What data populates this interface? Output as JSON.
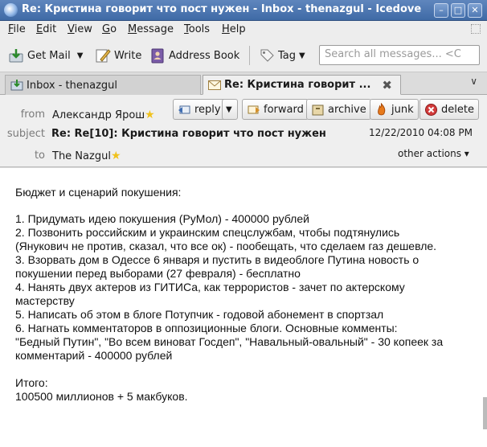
{
  "window": {
    "title": "Re: Кристина говорит что пост нужен - Inbox - thenazgul - Icedove"
  },
  "menu": [
    {
      "u": "F",
      "rest": "ile"
    },
    {
      "u": "E",
      "rest": "dit"
    },
    {
      "u": "V",
      "rest": "iew"
    },
    {
      "u": "G",
      "rest": "o"
    },
    {
      "u": "M",
      "rest": "essage"
    },
    {
      "u": "T",
      "rest": "ools"
    },
    {
      "u": "H",
      "rest": "elp"
    }
  ],
  "toolbar": {
    "get_mail": "Get Mail",
    "write": "Write",
    "address_book": "Address Book",
    "tag": "Tag",
    "search_placeholder": "Search all messages... <C"
  },
  "tabs": {
    "inbox_label": "Inbox - thenazgul",
    "message_label": "Re: Кристина говорит ..."
  },
  "header": {
    "from_label": "from",
    "from_value": "Александр Ярош",
    "subject_label": "subject",
    "subject_value": "Re: Re[10]: Кристина говорит что пост нужен",
    "to_label": "to",
    "to_value": "The Nazgul",
    "date": "12/22/2010 04:08 PM",
    "other_actions": "other actions",
    "buttons": {
      "reply": "reply",
      "forward": "forward",
      "archive": "archive",
      "junk": "junk",
      "delete": "delete"
    }
  },
  "body_lines": [
    "Бюджет и сценарий покушения:",
    "",
    "1. Придумать идею покушения (РуМол) - 400000 рублей",
    "2. Позвонить российским и украинским спецслужбам, чтобы подтянулись",
    "(Янукович не против, сказал, что все ок)  - пообещать, что сделаем газ дешевле.",
    "3. Взорвать дом в Одессе 6 января и пустить в видеоблоге Путина новость о",
    "покушении перед выборами (27 февраля) - бесплатно",
    "4. Нанять двух актеров из ГИТИСа, как террористов - зачет по актерскому",
    "мастерству",
    "5. Написать об этом в блоге Потупчик - годовой абонемент в спортзал",
    "6. Нагнать комментаторов в оппозиционные блоги. Основные комменты:",
    "\"Бедный Путин\", \"Во всем виноват Госдеп\", \"Навальный-овальный\" - 30 копеек за",
    "комментарий - 400000 рублей",
    "",
    "Итого:",
    "100500 миллионов + 5 макбуков."
  ]
}
